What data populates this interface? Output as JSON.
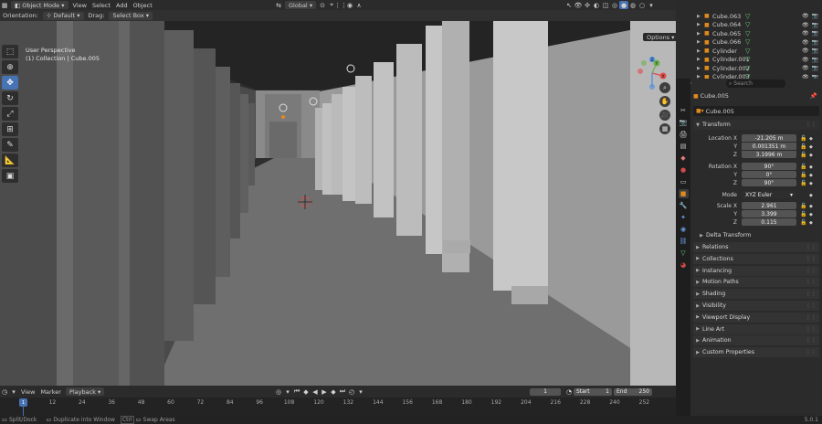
{
  "header": {
    "mode": "Object Mode",
    "menu": [
      "View",
      "Select",
      "Add",
      "Object"
    ],
    "transform_orientation": "Global",
    "options": "Options"
  },
  "header2": {
    "orientation_label": "Orientation:",
    "orientation_value": "Default",
    "drag_label": "Drag:",
    "drag_value": "Select Box"
  },
  "viewport": {
    "line1": "User Perspective",
    "line2": "(1) Collection | Cube.005",
    "gizmo": {
      "x": "X",
      "y": "Y",
      "z": "Z"
    }
  },
  "outliner": {
    "items": [
      {
        "name": "Cube.063"
      },
      {
        "name": "Cube.064"
      },
      {
        "name": "Cube.065"
      },
      {
        "name": "Cube.066"
      },
      {
        "name": "Cylinder"
      },
      {
        "name": "Cylinder.001"
      },
      {
        "name": "Cylinder.002"
      },
      {
        "name": "Cylinder.003"
      }
    ]
  },
  "properties": {
    "search_placeholder": "Search",
    "object_name": "Cube.005",
    "datablock_name": "Cube.005",
    "transform_title": "Transform",
    "location": {
      "label": "Location X",
      "x": "-21.205 m",
      "y": "0.001351 m",
      "z": "3.1996 m"
    },
    "rotation": {
      "label": "Rotation X",
      "x": "90°",
      "y": "0°",
      "z": "90°"
    },
    "mode": {
      "label": "Mode",
      "value": "XYZ Euler"
    },
    "scale": {
      "label": "Scale X",
      "x": "2.961",
      "y": "3.399",
      "z": "0.115"
    },
    "axis_labels": {
      "y": "Y",
      "z": "Z"
    },
    "delta_transform": "Delta Transform",
    "panels": [
      "Relations",
      "Collections",
      "Instancing",
      "Motion Paths",
      "Shading",
      "Visibility",
      "Viewport Display",
      "Line Art",
      "Animation",
      "Custom Properties"
    ]
  },
  "timeline": {
    "menu": [
      "View",
      "Marker",
      "Playback"
    ],
    "current_frame": "1",
    "start_label": "Start",
    "start": "1",
    "end_label": "End",
    "end": "250",
    "ticks": [
      "1",
      "12",
      "24",
      "36",
      "48",
      "60",
      "72",
      "84",
      "96",
      "108",
      "120",
      "132",
      "144",
      "156",
      "168",
      "180",
      "192",
      "204",
      "216",
      "228",
      "240",
      "252"
    ],
    "current_marker": "1"
  },
  "status": {
    "items": [
      "Split/Dock",
      "Duplicate into Window",
      "Swap Areas"
    ],
    "ctrl": "Ctrl",
    "version": "5.0.1"
  },
  "colors": {
    "accent": "#4772b3",
    "header": "#2b2b2b",
    "panel": "#333333",
    "field": "#545454"
  }
}
